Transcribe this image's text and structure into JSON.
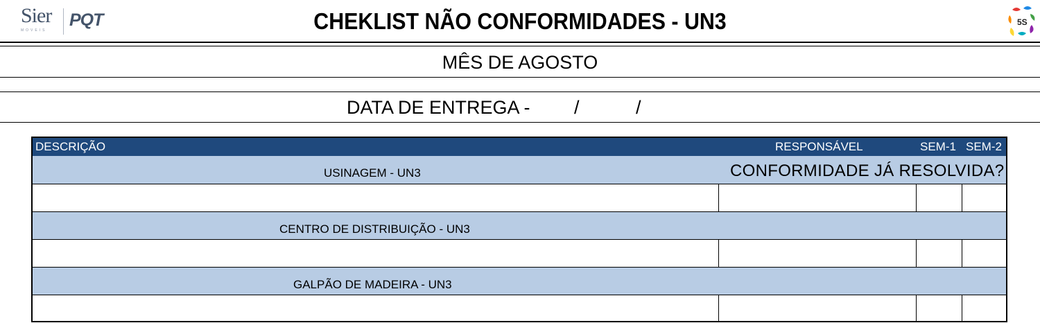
{
  "header": {
    "logo_sier": "Sier",
    "logo_sier_sub": "MOVEIS",
    "logo_pqt": "PQT",
    "logo_5s": "5S",
    "title": "CHEKLIST NÃO CONFORMIDADES - UN3"
  },
  "month_line": "MÊS DE AGOSTO",
  "delivery": {
    "label": "DATA DE ENTREGA -",
    "sep1": "/",
    "sep2": "/"
  },
  "table": {
    "columns": {
      "description": "DESCRIÇÃO",
      "responsible": "RESPONSÁVEL",
      "sem1": "SEM-1",
      "sem2": "SEM-2"
    },
    "conformity_question": "CONFORMIDADE JÁ RESOLVIDA?",
    "sections": [
      {
        "label": "USINAGEM - UN3",
        "rows": [
          {
            "description": "",
            "responsible": "",
            "sem1": "",
            "sem2": ""
          }
        ]
      },
      {
        "label": "CENTRO DE DISTRIBUIÇÃO - UN3",
        "rows": [
          {
            "description": "",
            "responsible": "",
            "sem1": "",
            "sem2": ""
          }
        ]
      },
      {
        "label": "GALPÃO DE MADEIRA - UN3",
        "rows": [
          {
            "description": "",
            "responsible": "",
            "sem1": "",
            "sem2": ""
          }
        ]
      }
    ]
  },
  "colors": {
    "header_bg": "#1f497d",
    "section_bg": "#b8cce4",
    "logo_text": "#44546a"
  }
}
